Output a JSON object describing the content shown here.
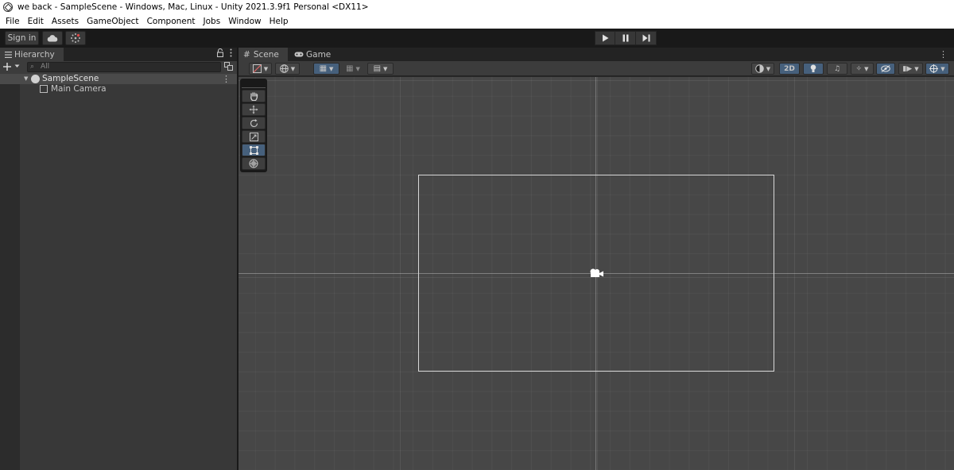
{
  "window": {
    "title": "we back - SampleScene - Windows, Mac, Linux - Unity 2021.3.9f1 Personal <DX11>"
  },
  "menu": [
    "File",
    "Edit",
    "Assets",
    "GameObject",
    "Component",
    "Jobs",
    "Window",
    "Help"
  ],
  "toolbar": {
    "sign_in_label": "Sign in",
    "cloud_icon": "cloud-icon",
    "collab_icon": "collab-icon",
    "play_icon": "play-icon",
    "pause_icon": "pause-icon",
    "step_icon": "step-icon"
  },
  "hierarchy": {
    "tab_label": "Hierarchy",
    "search_placeholder": "All",
    "scene_name": "SampleScene",
    "children": [
      "Main Camera"
    ]
  },
  "scene_view": {
    "tabs": [
      {
        "label": "Scene",
        "active": true
      },
      {
        "label": "Game",
        "active": false
      }
    ],
    "mode_2d_label": "2D",
    "accent_color": "#46607c"
  }
}
